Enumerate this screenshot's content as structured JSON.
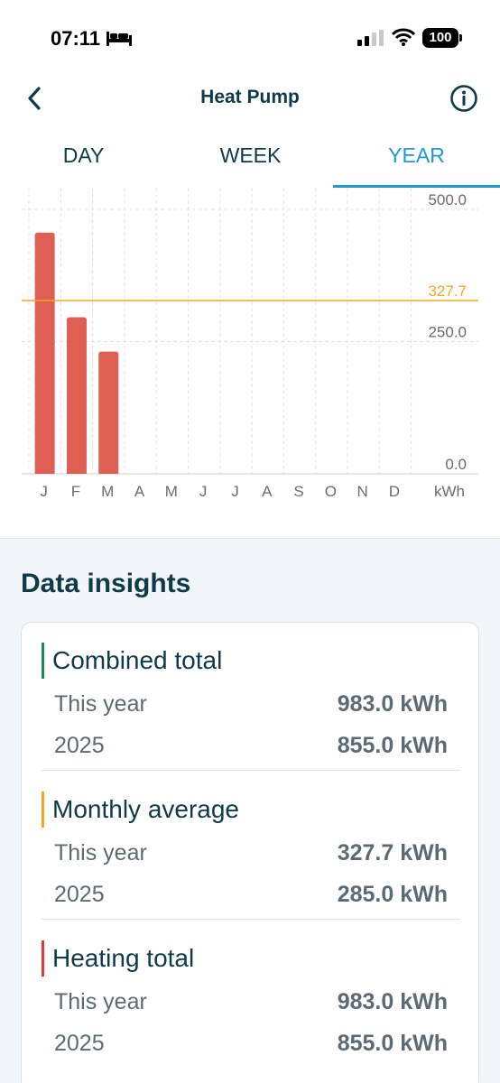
{
  "status_bar": {
    "time": "07:11",
    "battery": "100"
  },
  "header": {
    "title": "Heat Pump"
  },
  "tabs": [
    {
      "label": "DAY",
      "active": false
    },
    {
      "label": "WEEK",
      "active": false
    },
    {
      "label": "YEAR",
      "active": true
    }
  ],
  "colors": {
    "bar": "#e05f55",
    "average_line": "#f5a623",
    "accent": "#1e9ad1",
    "combined": "#1f8a4c",
    "average": "#f5a623",
    "heating": "#e03a32"
  },
  "chart_data": {
    "type": "bar",
    "categories": [
      "J",
      "F",
      "M",
      "A",
      "M",
      "J",
      "J",
      "A",
      "S",
      "O",
      "N",
      "D"
    ],
    "values": [
      456,
      296,
      231,
      null,
      null,
      null,
      null,
      null,
      null,
      null,
      null,
      null
    ],
    "unit_label": "kWh",
    "yticks": [
      0.0,
      250.0,
      500.0
    ],
    "ytick_labels": [
      "0.0",
      "250.0",
      "500.0"
    ],
    "ylim": [
      0,
      500
    ],
    "average": 327.7,
    "average_label": "327.7",
    "grid": true
  },
  "insights": {
    "title": "Data insights",
    "sections": [
      {
        "title": "Combined total",
        "color": "#1f8a4c",
        "rows": [
          {
            "label": "This year",
            "value": "983.0 kWh"
          },
          {
            "label": "2025",
            "value": "855.0 kWh"
          }
        ]
      },
      {
        "title": "Monthly average",
        "color": "#f5a623",
        "rows": [
          {
            "label": "This year",
            "value": "327.7 kWh"
          },
          {
            "label": "2025",
            "value": "285.0 kWh"
          }
        ]
      },
      {
        "title": "Heating total",
        "color": "#e03a32",
        "rows": [
          {
            "label": "This year",
            "value": "983.0 kWh"
          },
          {
            "label": "2025",
            "value": "855.0 kWh"
          }
        ]
      }
    ]
  }
}
